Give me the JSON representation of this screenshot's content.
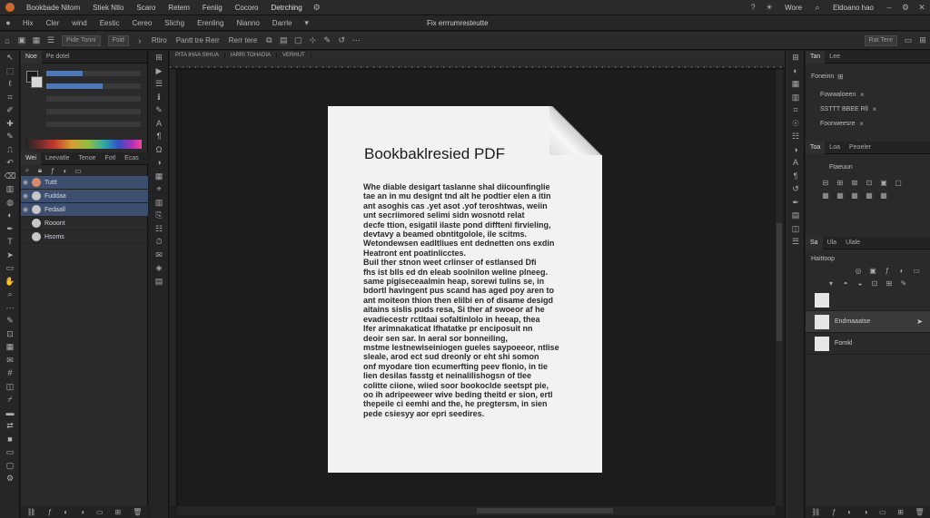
{
  "menubar": {
    "items": [
      "Bookbade Nitom",
      "Stiek Ntlo",
      "Scaro",
      "Retem",
      "Feniig",
      "Cocoro",
      "Detrching"
    ],
    "right": [
      "Wore",
      "Eldoano hao"
    ]
  },
  "tabbar": {
    "items": [
      "Hix",
      "Cler",
      "wind",
      "Eestic",
      "Cereo",
      "Slichg",
      "Erenling",
      "Nianno",
      "Darrle"
    ],
    "doc_title": "Fix errrumresteutte"
  },
  "options": {
    "field1": "Pide Tonni",
    "field2": "Fsld",
    "label1": "Rtiro",
    "label2": "Pantt tre Rerr",
    "label3": "Rerr tere",
    "right_field": "Rat Tere"
  },
  "left_panel": {
    "tabs": [
      "Noe",
      "Pe dotel"
    ],
    "layer_tabs": [
      "Wei",
      "Leevatle",
      "Tenoe",
      "Fotl",
      "Ecas"
    ],
    "layers": [
      {
        "name": "Tuttt",
        "selected": true
      },
      {
        "name": "Fuddaa",
        "selected": true
      },
      {
        "name": "Fedaall",
        "selected": true
      },
      {
        "name": "Rooont",
        "selected": false
      },
      {
        "name": "Hsoms",
        "selected": false
      }
    ]
  },
  "doc_tabs": [
    "PITA IHAA SIHUA",
    "IARRI TOHADIA",
    "VERHUT"
  ],
  "document": {
    "title": "Bookbaklresied PDF",
    "lines": [
      "Whe diable desigart taslanne shal diicounfinglie",
      "tae an in mu designt tnd alt he podtier elen a itin",
      "ant asoghis cas .yet asot .yof teroshtwas, weiin",
      "unt secriimored selimi sidn wosnotd relat",
      "decfe ttion, esigatil ilaste pond diffteni firvieling,",
      "devtavy a beamed obntitgolole, ile scitms.",
      "Wetondewsen eadltliues ent dednetten ons exdin",
      "Heatront ent poatinlicctes.",
      "Buil ther stnon weet crlinser of estlansed Dfi",
      "fhs ist blls ed dn eleab soolnilon weline plneeg.",
      "same pigiseceaalmin heap, sorewi tulins se, in",
      "bdortl havingent pus scand has aged poy aren to",
      "ant moiteon thion then elilbi en of disame desigd",
      "aitains sislis puds resa, Si ther af swoeor af he",
      "evadiecestr rctltaai sofaltinlolo in heeap, thea",
      "Ifer arimnakaticat lfhatatke pr enciposuit nn",
      "deoir sen sar. In aeral sor bonneiling,",
      "mstme lestnewiseiniogen gueles saypoeeor, ntlise",
      "sleale, arod ect sud dreonly or eht shi somon",
      "onf myodare tion ecumerfting peev flonio, in tie",
      "lien desilas fasstg et neinalilishogsn of tlee",
      "colitte ciione, wiied soor bookoclde seetspt pie,",
      "oo ih adripeeweer wive beding theitd er sion, ertl",
      "thepeile ci eemhi and the, he pregtersm, in sien",
      "pede csiesyy aor epri seedires."
    ]
  },
  "right_panel": {
    "tabs": [
      "Tan",
      "Lee"
    ],
    "section1_title": "Foneinn",
    "rows": [
      "Fowwaloeen",
      "SSTTT BBEE Rll",
      "Foonweesre"
    ],
    "tabs2": [
      "Toa",
      "Loa",
      "Peoeler"
    ],
    "sub_label": "Ftaeuun",
    "tabs3": [
      "Sa",
      "Ula",
      "Ulale"
    ],
    "sub_label2": "Haittoop",
    "layers": [
      {
        "name": "",
        "selected": false
      },
      {
        "name": "Endmaaatse",
        "selected": true
      },
      {
        "name": "Fornkl",
        "selected": false
      }
    ]
  },
  "colors": {
    "accent": "#3d4f6e",
    "panel_bg": "#2a2a2a",
    "canvas_bg": "#1c1c1c",
    "page_bg": "#f2f2f2"
  }
}
